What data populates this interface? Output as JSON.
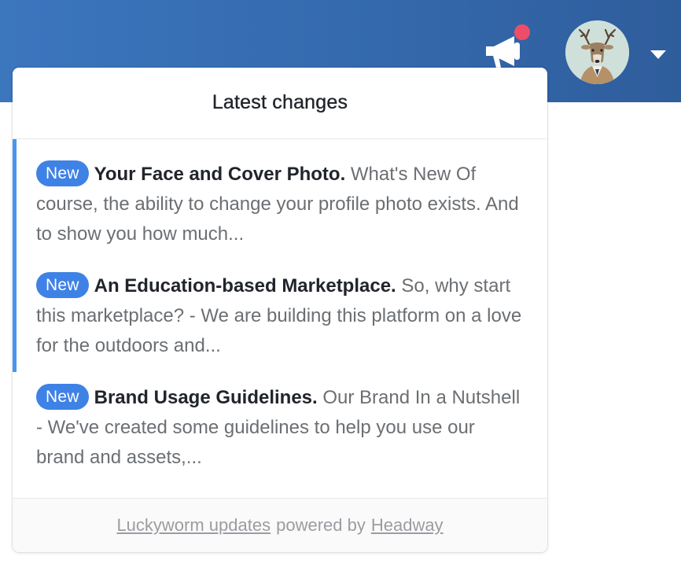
{
  "topbar": {
    "colors": {
      "gradient_start": "#3c76bd",
      "gradient_end": "#2f5d9c",
      "notification_dot": "#ee4d6a"
    },
    "announcements_icon": "megaphone-icon",
    "avatar_icon": "deer-avatar",
    "menu_icon": "caret-down-icon"
  },
  "panel": {
    "title": "Latest changes",
    "badge_color": "#3f82e6",
    "unread_bar_color": "#4a95ef",
    "entries": [
      {
        "badge": "New",
        "title": "Your Face and Cover Photo.",
        "body": "What's New Of course, the ability to change your profile photo exists. And to show you how much...",
        "unread": true
      },
      {
        "badge": "New",
        "title": "An Education-based Marketplace.",
        "body": "So, why start this marketplace? - We are building this platform on a love for the outdoors and...",
        "unread": true
      },
      {
        "badge": "New",
        "title": "Brand Usage Guidelines.",
        "body": "Our Brand In a Nutshell - We've created some guidelines to help you use our brand and assets,...",
        "unread": false
      }
    ],
    "footer": {
      "link1": "Luckyworm updates",
      "middle": "powered by",
      "link2": "Headway"
    }
  }
}
